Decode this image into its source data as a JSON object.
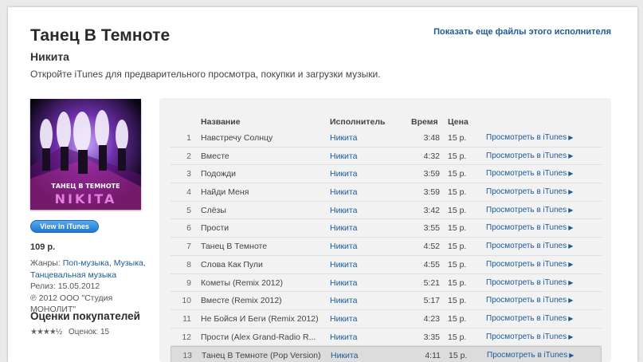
{
  "header": {
    "title": "Танец В Темноте",
    "artist": "Никита",
    "promo": "Откройте iTunes для предварительного просмотра, покупки и загрузки музыки.",
    "more_link": "Показать еще файлы этого исполнителя"
  },
  "sidebar": {
    "cover_text": "ТАНЕЦ В ТЕМНОТЕ",
    "cover_logo": "NIKITA",
    "view_button": "View In iTunes",
    "price": "109 р.",
    "genres_label": "Жанры:",
    "genres": [
      "Поп-музыка",
      "Музыка",
      "Танцевальная музыка"
    ],
    "release_label": "Релиз:",
    "release_date": "15.05.2012",
    "copyright": "℗ 2012 ООО \"Студия МОНОЛИТ\"",
    "ratings_title": "Оценки покупателей",
    "stars": "★★★★½",
    "rating_label": "Оценок:",
    "rating_count": "15"
  },
  "table": {
    "columns": {
      "name": "Название",
      "artist": "Исполнитель",
      "time": "Время",
      "price": "Цена"
    },
    "view_label": "Просмотреть в iTunes",
    "rows": [
      {
        "num": "1",
        "name": "Навстречу Солнцу",
        "artist": "Никита",
        "time": "3:48",
        "price": "15 р."
      },
      {
        "num": "2",
        "name": "Вместе",
        "artist": "Никита",
        "time": "4:32",
        "price": "15 р."
      },
      {
        "num": "3",
        "name": "Подожди",
        "artist": "Никита",
        "time": "3:59",
        "price": "15 р."
      },
      {
        "num": "4",
        "name": "Найди Меня",
        "artist": "Никита",
        "time": "3:59",
        "price": "15 р."
      },
      {
        "num": "5",
        "name": "Слёзы",
        "artist": "Никита",
        "time": "3:42",
        "price": "15 р."
      },
      {
        "num": "6",
        "name": "Прости",
        "artist": "Никита",
        "time": "3:55",
        "price": "15 р."
      },
      {
        "num": "7",
        "name": "Танец В Темноте",
        "artist": "Никита",
        "time": "4:52",
        "price": "15 р."
      },
      {
        "num": "8",
        "name": "Слова Как Пули",
        "artist": "Никита",
        "time": "4:55",
        "price": "15 р."
      },
      {
        "num": "9",
        "name": "Кометы (Remix 2012)",
        "artist": "Никита",
        "time": "5:21",
        "price": "15 р."
      },
      {
        "num": "10",
        "name": "Вместе (Remix 2012)",
        "artist": "Никита",
        "time": "5:17",
        "price": "15 р."
      },
      {
        "num": "11",
        "name": "Не Бойся И Беги (Remix 2012)",
        "artist": "Никита",
        "time": "4:23",
        "price": "15 р."
      },
      {
        "num": "12",
        "name": "Прости (Alex Grand-Radio R...",
        "artist": "Никита",
        "time": "3:35",
        "price": "15 р."
      },
      {
        "num": "13",
        "name": "Танец В Темноте (Pop Version)",
        "artist": "Никита",
        "time": "4:11",
        "price": "15 р."
      }
    ]
  }
}
